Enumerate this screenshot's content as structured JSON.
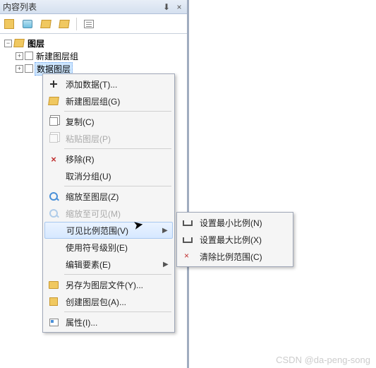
{
  "panel": {
    "title": "内容列表"
  },
  "tree": {
    "root": "图层",
    "group": "新建图层组",
    "selected": "数据图层"
  },
  "menu": {
    "add_data": "添加数据(T)...",
    "new_group": "新建图层组(G)",
    "copy": "复制(C)",
    "paste": "粘贴图层(P)",
    "remove": "移除(R)",
    "ungroup": "取消分组(U)",
    "zoom_layer": "缩放至图层(Z)",
    "zoom_visible": "缩放至可见(M)",
    "visible_scale": "可见比例范围(V)",
    "symbol_level": "使用符号级别(E)",
    "edit_features": "编辑要素(E)",
    "save_as": "另存为图层文件(Y)...",
    "create_pkg": "创建图层包(A)...",
    "properties": "属性(I)..."
  },
  "submenu": {
    "set_min": "设置最小比例(N)",
    "set_max": "设置最大比例(X)",
    "clear": "清除比例范围(C)"
  },
  "watermark": "CSDN @da-peng-song"
}
